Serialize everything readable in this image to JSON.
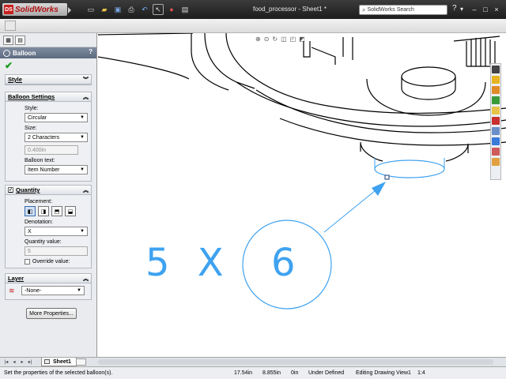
{
  "titlebar": {
    "app_name": "SolidWorks",
    "logo_mark": "DS",
    "doc_title": "food_processor - Sheet1 *",
    "search_placeholder": "SolidWorks Search",
    "right_glyphs": [
      "?",
      "▾"
    ],
    "window_buttons": [
      "–",
      "□",
      "×"
    ]
  },
  "toolbar_icons": [
    "new-icon",
    "open-icon",
    "save-icon",
    "print-icon",
    "undo-icon",
    "select-icon",
    "rebuild-icon",
    "options-icon"
  ],
  "panel": {
    "title": "Balloon",
    "help": "?",
    "style_group": {
      "title": "Style"
    },
    "balloon_settings": {
      "title": "Balloon Settings",
      "style_label": "Style:",
      "style_value": "Circular",
      "size_label": "Size:",
      "size_value": "2 Characters",
      "size_custom_value": "0.400in",
      "text_label": "Balloon text:",
      "text_value": "Item Number"
    },
    "quantity": {
      "title": "Quantity",
      "placement_label": "Placement:",
      "denotation_label": "Denotation:",
      "denotation_value": "X",
      "value_label": "Quantity value:",
      "value": "5",
      "override_label": "Override value:"
    },
    "layer": {
      "title": "Layer",
      "value": "-None-"
    },
    "more_properties": "More Properties..."
  },
  "drawing": {
    "quantity_text": "5 X",
    "balloon_number": "6",
    "accent_color": "#3ea2f0"
  },
  "sheetbar": {
    "nav_buttons": [
      "|◂",
      "◂",
      "▸",
      "▸|"
    ],
    "active_sheet": "Sheet1"
  },
  "status": {
    "message": "Set the properties of the selected balloon(s).",
    "x": "17.54in",
    "y": "8.855in",
    "z": "0in",
    "state": "Under Defined",
    "mode": "Editing Drawing View1",
    "extra": "1:4"
  }
}
